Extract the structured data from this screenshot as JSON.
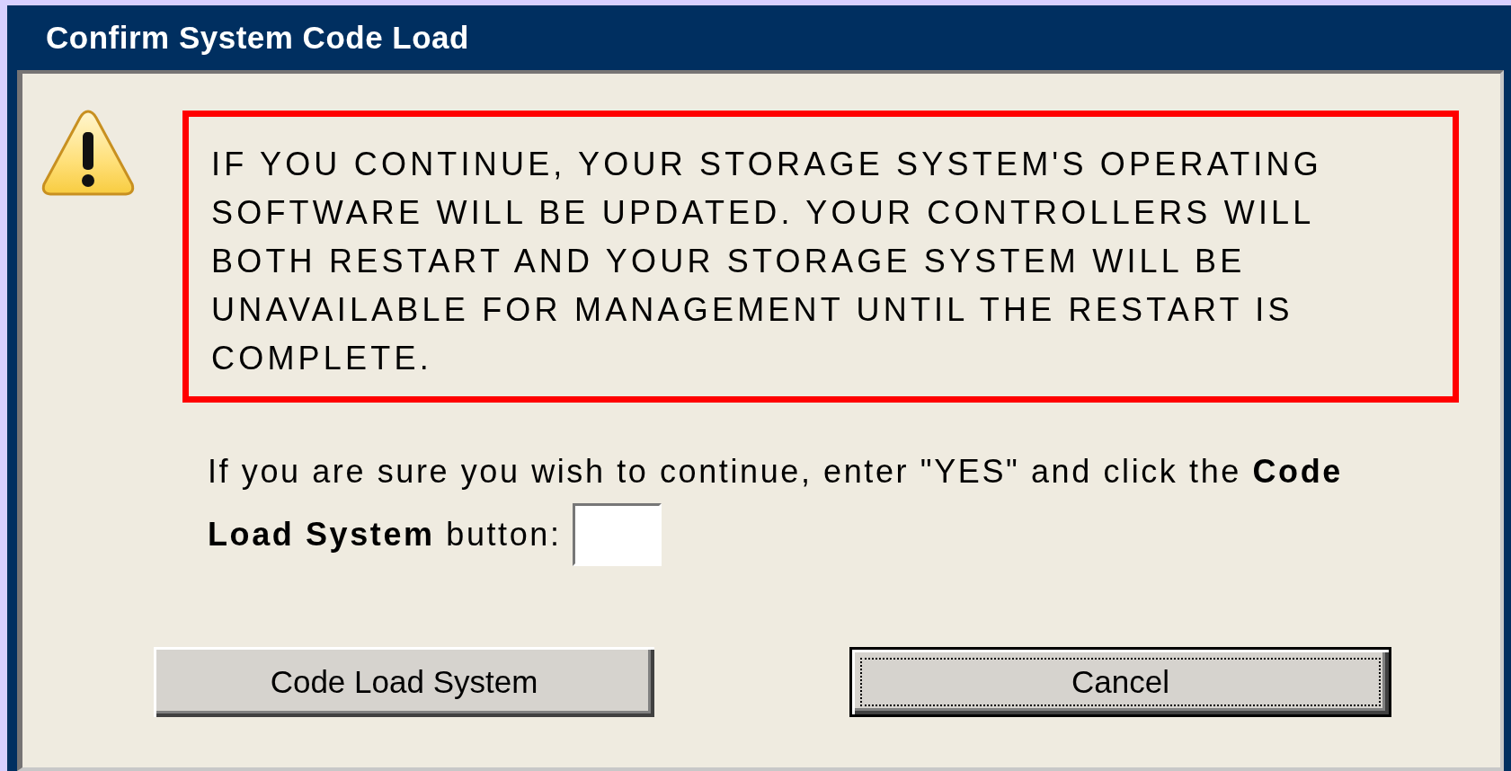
{
  "window": {
    "title": "Confirm System Code Load"
  },
  "warning": {
    "text": "IF YOU CONTINUE, YOUR STORAGE SYSTEM'S OPERATING SOFTWARE WILL BE UPDATED. YOUR CONTROLLERS WILL BOTH RESTART AND YOUR STORAGE SYSTEM WILL BE UNAVAILABLE FOR MANAGEMENT UNTIL THE RESTART IS COMPLETE."
  },
  "prompt": {
    "lines": [
      "If you are sure you wish to continue, enter \"YES\" and click the **Code**",
      "**Load System** button:"
    ]
  },
  "buttons": [
    {
      "label": "Code Load System",
      "focused": false
    },
    {
      "label": "Cancel",
      "focused": true
    }
  ]
}
